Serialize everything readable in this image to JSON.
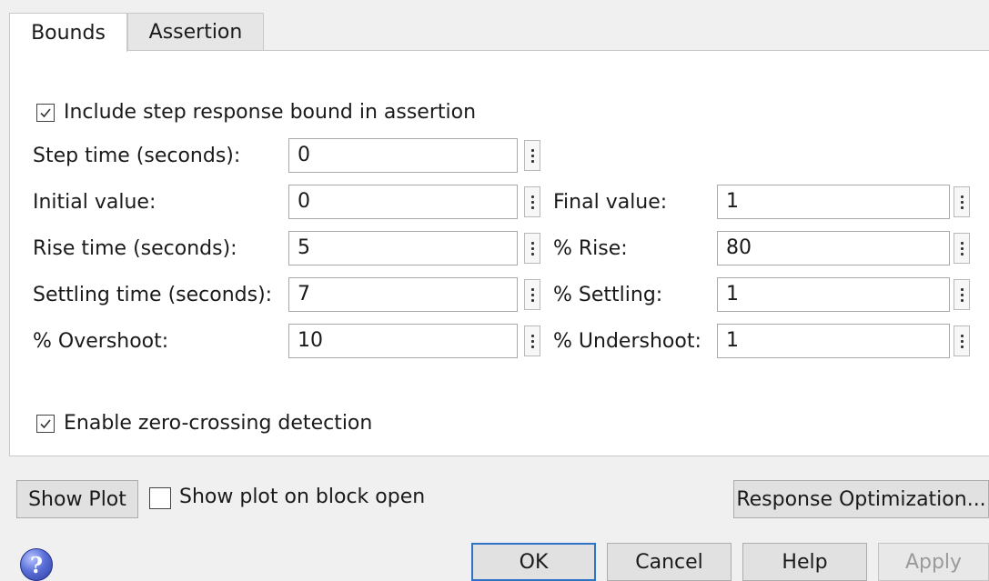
{
  "tabs": [
    {
      "label": "Bounds",
      "active": true
    },
    {
      "label": "Assertion",
      "active": false
    }
  ],
  "bounds": {
    "include_bound": {
      "label": "Include step response bound in assertion",
      "checked": true
    },
    "step_time": {
      "label": "Step time (seconds):",
      "value": "0"
    },
    "initial_value": {
      "label": "Initial value:",
      "value": "0"
    },
    "final_value": {
      "label": "Final value:",
      "value": "1"
    },
    "rise_time": {
      "label": "Rise time (seconds):",
      "value": "5"
    },
    "percent_rise": {
      "label": "% Rise:",
      "value": "80"
    },
    "settling_time": {
      "label": "Settling time (seconds):",
      "value": "7"
    },
    "percent_settling": {
      "label": "% Settling:",
      "value": "1"
    },
    "percent_overshoot": {
      "label": "% Overshoot:",
      "value": "10"
    },
    "percent_undershoot": {
      "label": "% Undershoot:",
      "value": "1"
    },
    "zero_crossing": {
      "label": "Enable zero-crossing detection",
      "checked": true
    }
  },
  "plot_controls": {
    "show_plot_label": "Show Plot",
    "show_on_open": {
      "label": "Show plot on block open",
      "checked": false
    },
    "response_optimization_label": "Response Optimization..."
  },
  "dialog_buttons": {
    "help_icon": "question-mark-icon",
    "help_icon_glyph": "?",
    "ok_label": "OK",
    "cancel_label": "Cancel",
    "help_label": "Help",
    "apply_label": "Apply"
  },
  "colors": {
    "default_button_border": "#2f73c8",
    "panel_background": "#ffffff",
    "dialog_background": "#f0f0f0"
  }
}
